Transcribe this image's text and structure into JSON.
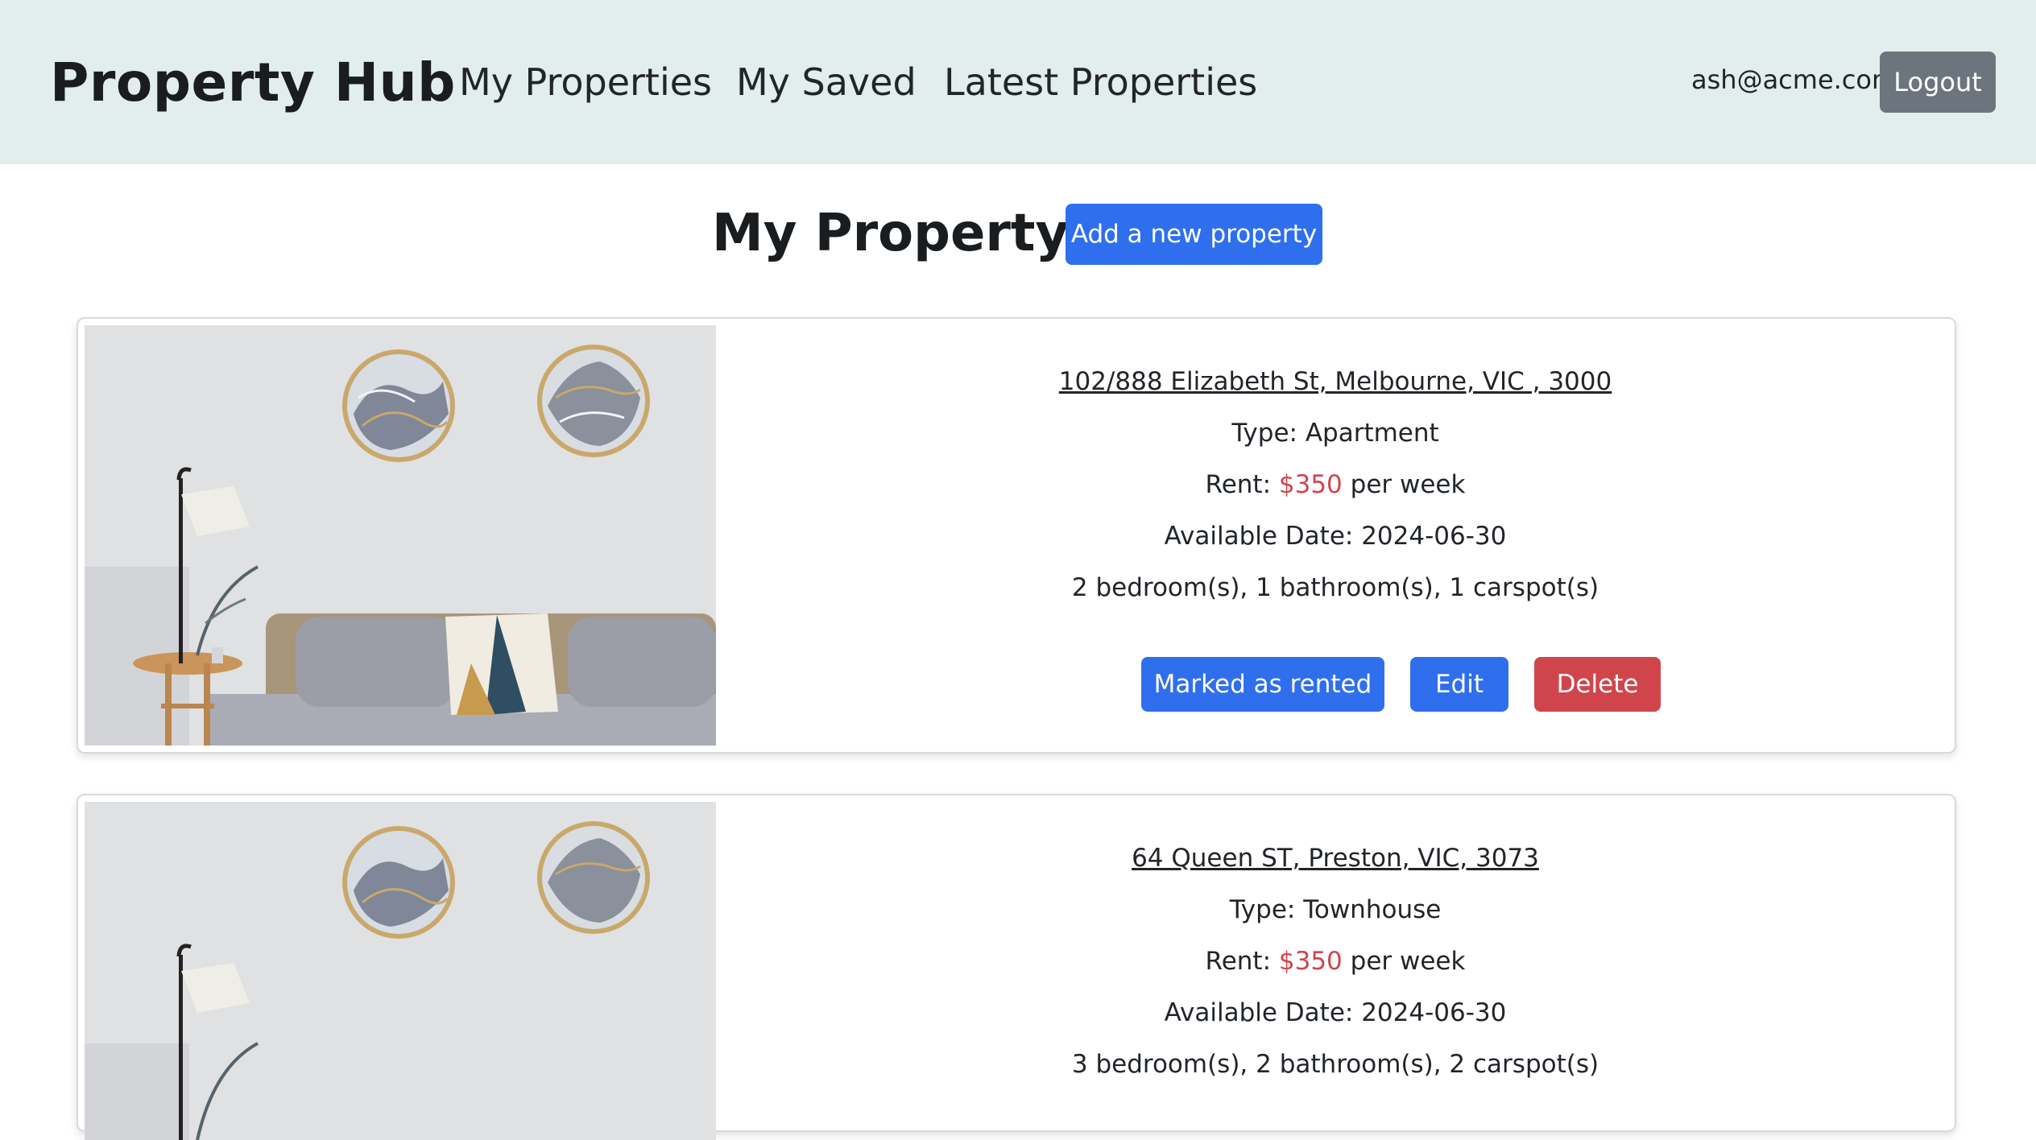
{
  "header": {
    "brand": "Property Hub",
    "nav": [
      "My Properties",
      "My Saved",
      "Latest Properties"
    ],
    "user_email": "ash@acme.com",
    "logout_label": "Logout"
  },
  "page": {
    "title": "My Property",
    "add_button": "Add a new property"
  },
  "properties": [
    {
      "address": "102/888 Elizabeth St, Melbourne, VIC , 3000",
      "type_label": "Type: Apartment",
      "rent_prefix": "Rent: ",
      "rent_price": "$350",
      "rent_suffix": " per week",
      "available": "Available Date: 2024-06-30",
      "rooms": "2 bedroom(s), 1 bathroom(s), 1 carspot(s)",
      "actions": {
        "rented": "Marked as rented",
        "edit": "Edit",
        "delete": "Delete"
      }
    },
    {
      "address": "64 Queen ST, Preston, VIC, 3073",
      "type_label": "Type: Townhouse",
      "rent_prefix": "Rent: ",
      "rent_price": "$350",
      "rent_suffix": " per week",
      "available": "Available Date: 2024-06-30",
      "rooms": "3 bedroom(s), 2 bathroom(s), 2 carspot(s)"
    }
  ],
  "colors": {
    "header_bg": "#e2eded",
    "primary": "#2f6fed",
    "danger": "#d0454c",
    "secondary": "#6c757d",
    "price": "#d0454c"
  }
}
